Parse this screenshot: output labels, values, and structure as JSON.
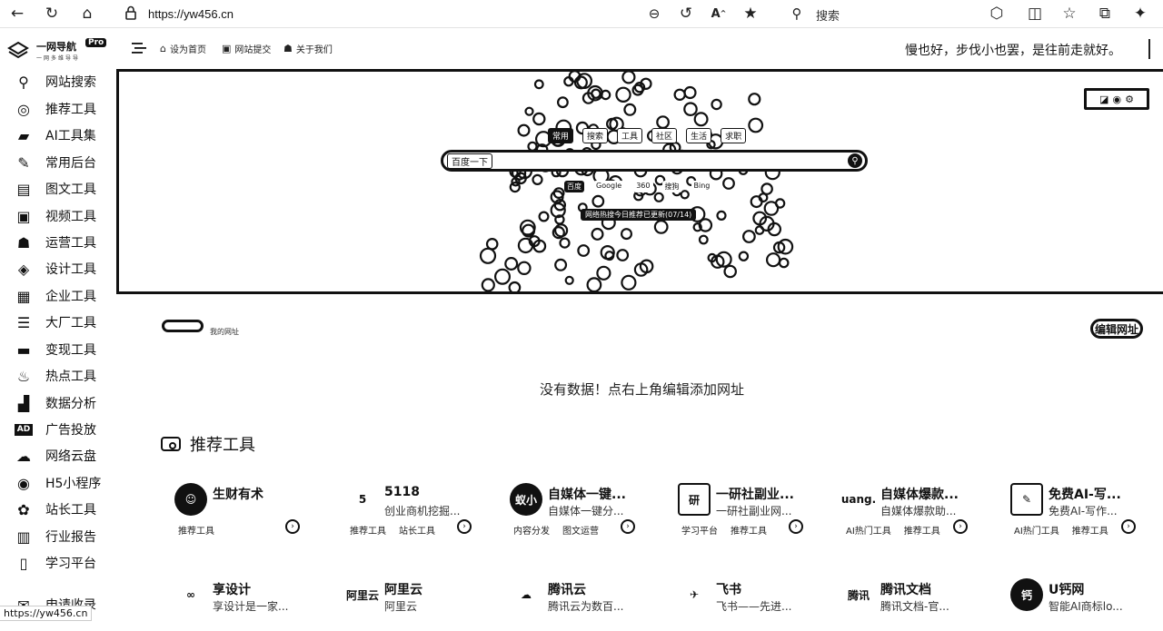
{
  "browser": {
    "url": "https://yw456.cn",
    "search_label": "搜索"
  },
  "app": {
    "logo_title": "一网导航",
    "logo_badge": "Pro",
    "logo_sub": "一网多维导导",
    "nav": [
      {
        "label": "设为首页",
        "icon": "home-icon"
      },
      {
        "label": "网站提交",
        "icon": "submit-icon"
      },
      {
        "label": "关于我们",
        "icon": "user-icon"
      }
    ],
    "slogan": "慢也好，步伐小也罢，是往前走就好。"
  },
  "sidebar": {
    "items": [
      {
        "label": "网站搜索",
        "icon": "search-icon",
        "glyph": "⚲"
      },
      {
        "label": "推荐工具",
        "icon": "target-icon",
        "glyph": "◎"
      },
      {
        "label": "AI工具集",
        "icon": "briefcase-icon",
        "glyph": "▰"
      },
      {
        "label": "常用后台",
        "icon": "wrench-icon",
        "glyph": "✎"
      },
      {
        "label": "图文工具",
        "icon": "document-icon",
        "glyph": "▤"
      },
      {
        "label": "视频工具",
        "icon": "video-icon",
        "glyph": "▣"
      },
      {
        "label": "运营工具",
        "icon": "users-icon",
        "glyph": "☗"
      },
      {
        "label": "设计工具",
        "icon": "layers-icon",
        "glyph": "◈"
      },
      {
        "label": "企业工具",
        "icon": "chart-box-icon",
        "glyph": "▦"
      },
      {
        "label": "大厂工具",
        "icon": "list-icon",
        "glyph": "☰"
      },
      {
        "label": "变现工具",
        "icon": "wallet-icon",
        "glyph": "▬"
      },
      {
        "label": "热点工具",
        "icon": "fire-icon",
        "glyph": "♨"
      },
      {
        "label": "数据分析",
        "icon": "bar-chart-icon",
        "glyph": "▟"
      },
      {
        "label": "广告投放",
        "icon": "ad-icon",
        "glyph": "AD"
      },
      {
        "label": "网络云盘",
        "icon": "cloud-icon",
        "glyph": "☁"
      },
      {
        "label": "H5小程序",
        "icon": "miniprogram-icon",
        "glyph": "◉"
      },
      {
        "label": "站长工具",
        "icon": "paw-icon",
        "glyph": "✿"
      },
      {
        "label": "行业报告",
        "icon": "clipboard-icon",
        "glyph": "▥"
      },
      {
        "label": "学习平台",
        "icon": "book-icon",
        "glyph": "▯"
      },
      {
        "label": "申请收录",
        "icon": "apply-icon",
        "glyph": "✉"
      }
    ]
  },
  "hero": {
    "tabs": [
      "常用",
      "搜索",
      "工具",
      "社区",
      "生活",
      "求职"
    ],
    "active_tab": "常用",
    "search_engine": "百度一下",
    "engines": [
      "百度",
      "Google",
      "360",
      "搜狗",
      "Bing"
    ],
    "active_engine": "百度",
    "notice": "网络热搜今日推荐已更新(07/14)"
  },
  "main": {
    "fav_text": "我的网址",
    "edit_button": "编辑网址",
    "no_data": "没有数据！点右上角编辑添加网址",
    "section_title": "推荐工具",
    "cards_row1": [
      {
        "name": "生财有术",
        "desc": "",
        "tags": [
          "推荐工具"
        ],
        "logo": "☺",
        "style": "round"
      },
      {
        "name": "5118",
        "desc": "创业商机挖掘...",
        "tags": [
          "推荐工具",
          "站长工具"
        ],
        "logo": "5",
        "style": "plain"
      },
      {
        "name": "自媒体一键...",
        "desc": "自媒体一键分...",
        "tags": [
          "内容分发",
          "图文运营"
        ],
        "logo": "蚁小",
        "style": "round"
      },
      {
        "name": "一研社副业...",
        "desc": "一研社副业网...",
        "tags": [
          "学习平台",
          "推荐工具"
        ],
        "logo": "研",
        "style": "box"
      },
      {
        "name": "自媒体爆款...",
        "desc": "自媒体爆款助...",
        "tags": [
          "AI热门工具",
          "推荐工具"
        ],
        "logo": "uang.",
        "style": "plain"
      },
      {
        "name": "免费AI-写...",
        "desc": "免费AI-写作...",
        "tags": [
          "AI热门工具",
          "推荐工具"
        ],
        "logo": "✎",
        "style": "box"
      }
    ],
    "cards_row2": [
      {
        "name": "享设计",
        "desc": "享设计是一家...",
        "logo": "∞",
        "style": "plain"
      },
      {
        "name": "阿里云",
        "desc": "阿里云",
        "logo": "阿里云",
        "style": "plain"
      },
      {
        "name": "腾讯云",
        "desc": "腾讯云为数百...",
        "logo": "☁",
        "style": "plain"
      },
      {
        "name": "飞书",
        "desc": "飞书——先进...",
        "logo": "✈",
        "style": "plain"
      },
      {
        "name": "腾讯文档",
        "desc": "腾讯文档-官...",
        "logo": "腾讯",
        "style": "plain"
      },
      {
        "name": "U钙网",
        "desc": "智能AI商标lo...",
        "logo": "钙",
        "style": "round"
      }
    ]
  },
  "status_url": "https://yw456.cn"
}
